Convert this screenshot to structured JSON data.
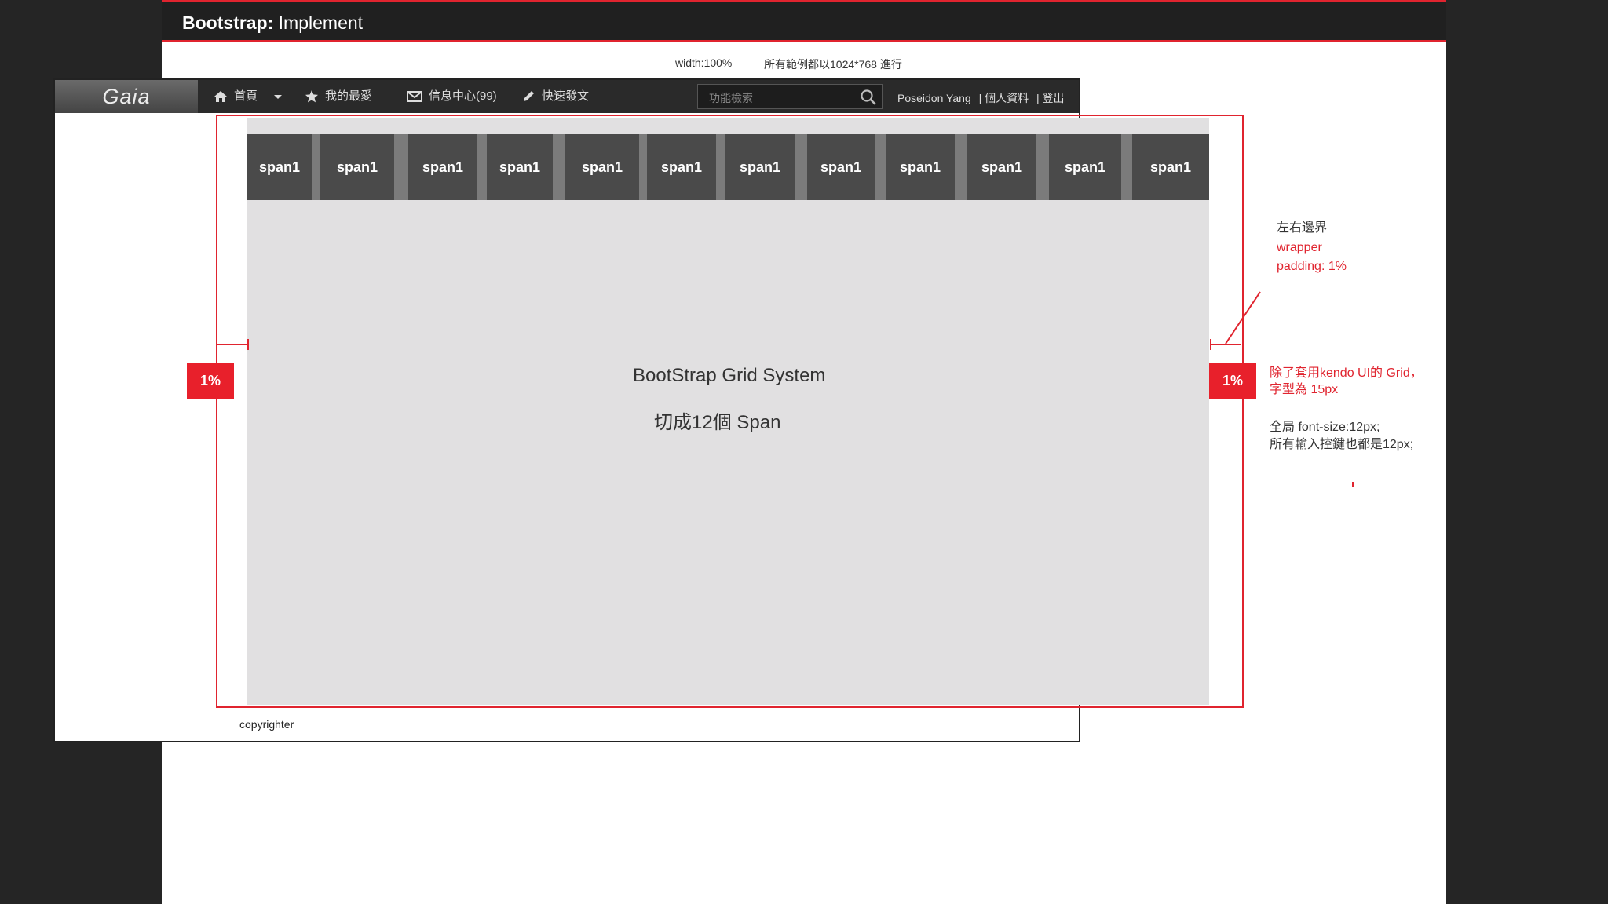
{
  "slide": {
    "title_bold": "Bootstrap:",
    "title_rest": " Implement",
    "note_width": "width:100%",
    "note_resolution": "所有範例都以1024*768 進行"
  },
  "navbar": {
    "logo": "Gaia",
    "items": [
      {
        "label": "首頁",
        "icon": "home-icon"
      },
      {
        "label": "我的最愛",
        "icon": "star-icon"
      },
      {
        "label": "信息中心(99)",
        "icon": "mail-icon"
      },
      {
        "label": "快速發文",
        "icon": "pencil-icon"
      }
    ],
    "search_placeholder": "功能檢索",
    "user_name": "Poseidon Yang",
    "profile_link": "| 個人資料",
    "logout_link": "| 登出"
  },
  "grid": {
    "span_label": "span1",
    "caption_line1": "BootStrap Grid System",
    "caption_line2": "切成12個 Span"
  },
  "footer": {
    "text": "copyrighter"
  },
  "annotations": {
    "left_badge": "1%",
    "right_badge": "1%",
    "wrapper_title": "左右邊界",
    "wrapper_name": "wrapper",
    "wrapper_padding": "padding: 1%",
    "kendo_line1": "除了套用kendo UI的 Grid，",
    "kendo_line2": "字型為 15px",
    "font_line1": "全局  font-size:12px;",
    "font_line2": "所有輸入控鍵也都是12px;"
  },
  "colors": {
    "accent": "#e0242f",
    "navbar": "#2a2a2a",
    "grid_bg": "#e1e0e1",
    "span": "#4a4a4a"
  }
}
